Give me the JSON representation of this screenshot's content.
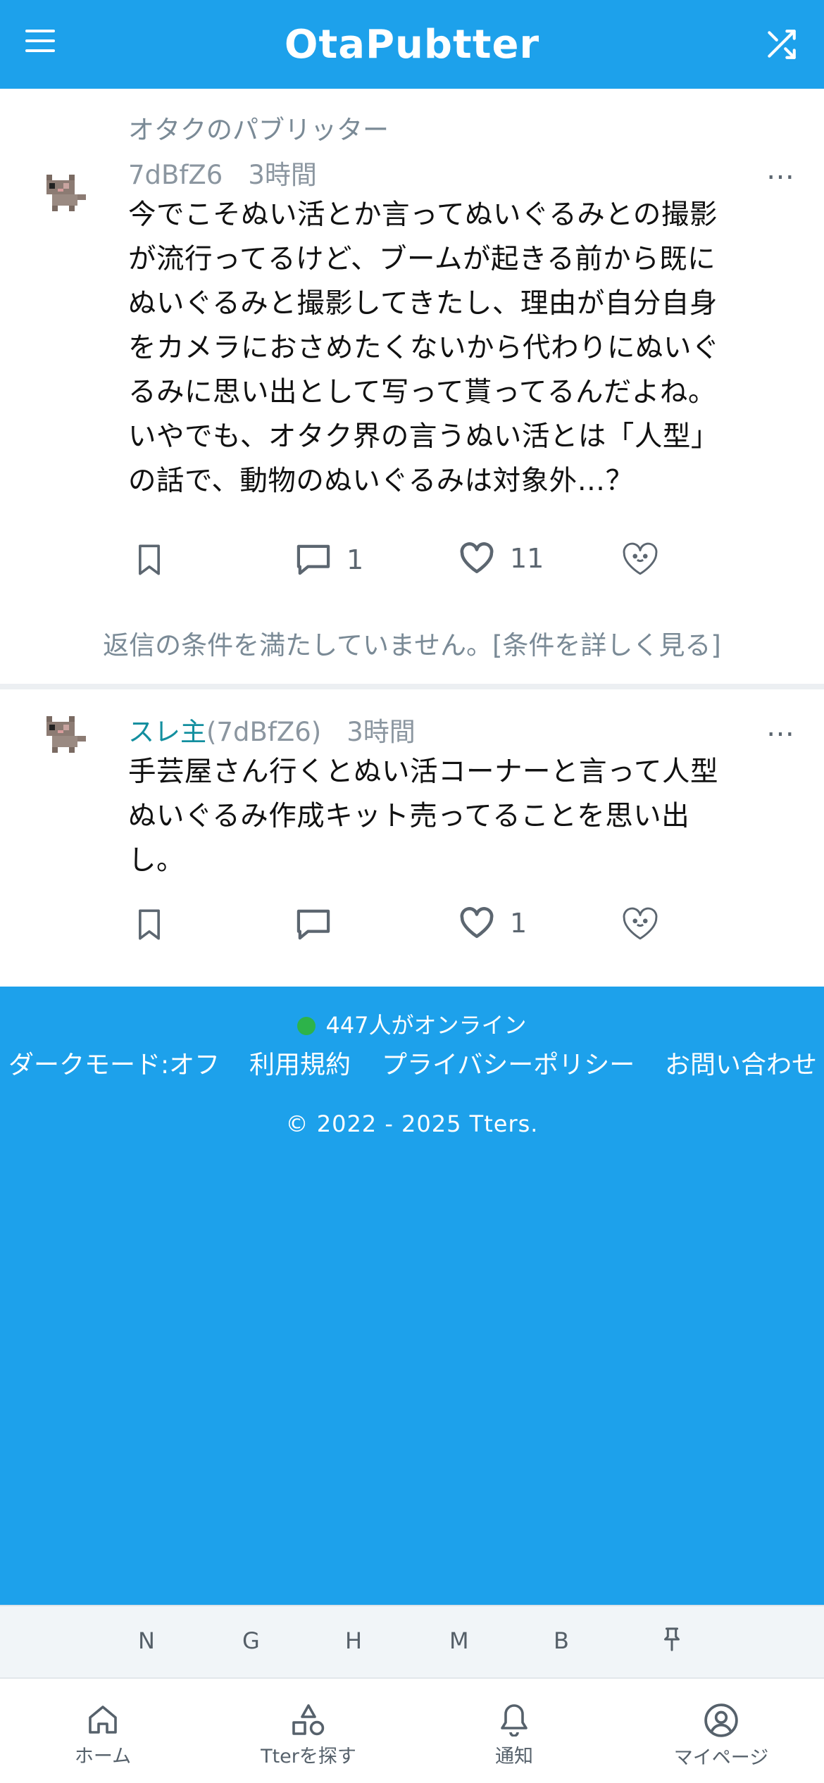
{
  "header": {
    "logo": "OtaPubtter",
    "menu_icon": "hamburger-menu-icon",
    "shuffle_icon": "shuffle-icon"
  },
  "posts": [
    {
      "board": "オタクのパブリッター",
      "author_id": "7dBfZ6",
      "time": "3時間",
      "more": "…",
      "body_lines": [
        "今でこそぬい活とか言ってぬいぐるみとの撮影",
        "が流行ってるけど、ブームが起きる前から既に",
        "ぬいぐるみと撮影してきたし、理由が自分自身",
        "をカメラにおさめたくないから代わりにぬいぐ",
        "るみに思い出として写って貰ってるんだよね。",
        "いやでも、オタク界の言うぬい活とは「人型」",
        "の話で、動物のぬいぐるみは対象外…？"
      ],
      "reply_count": "1",
      "like_count": "11",
      "reply_note": "返信の条件を満たしていません。",
      "reply_note_link": "[条件を詳しく見る]"
    },
    {
      "op_label": "スレ主",
      "author_id": "(7dBfZ6)",
      "time": "3時間",
      "more": "…",
      "body_lines": [
        "手芸屋さん行くとぬい活コーナーと言って人型",
        "ぬいぐるみ作成キット売ってることを思い出",
        "し。"
      ],
      "reply_count": "",
      "like_count": "1"
    }
  ],
  "footer": {
    "online": "447人がオンライン",
    "links": [
      "ダークモード:オフ",
      "利用規約",
      "プライバシーポリシー",
      "お問い合わせ"
    ],
    "copyright": "© 2022 - 2025 Tters."
  },
  "shortcuts": [
    "N",
    "G",
    "H",
    "M",
    "B",
    "⚲"
  ],
  "bottom_nav": [
    {
      "label": "ホーム",
      "icon": "home-icon"
    },
    {
      "label": "Tterを探す",
      "icon": "shapes-icon"
    },
    {
      "label": "通知",
      "icon": "bell-icon"
    },
    {
      "label": "マイページ",
      "icon": "user-circle-icon"
    }
  ],
  "colors": {
    "brand": "#1da1eb",
    "op": "#138f9f",
    "online_dot": "#2db34a"
  }
}
